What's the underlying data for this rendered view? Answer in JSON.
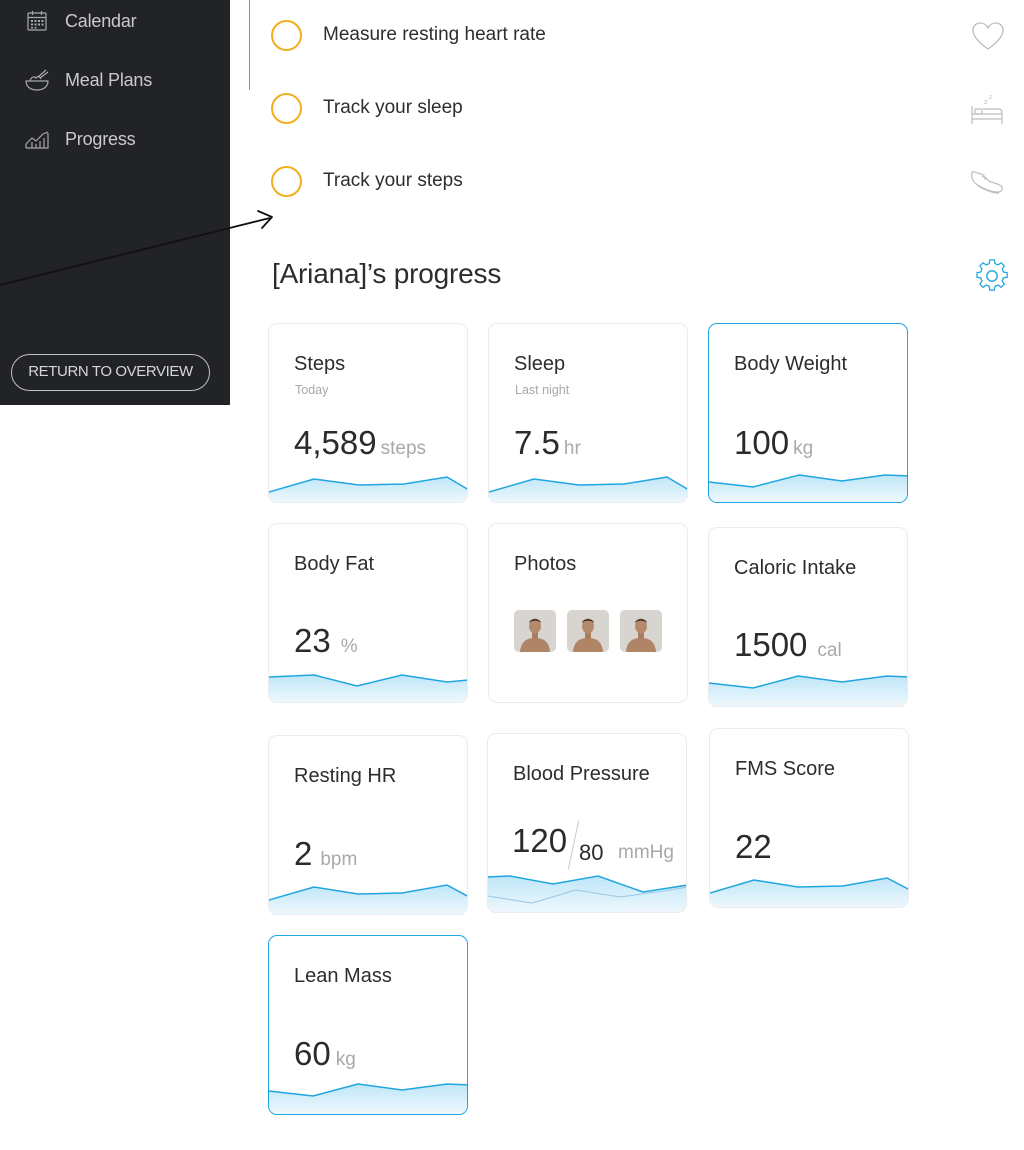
{
  "sidebar": {
    "items": [
      {
        "label": "Calendar",
        "icon": "calendar-icon"
      },
      {
        "label": "Meal Plans",
        "icon": "meal-bowl-icon"
      },
      {
        "label": "Progress",
        "icon": "progress-chart-icon"
      }
    ],
    "return_label": "RETURN TO OVERVIEW"
  },
  "tasks": [
    {
      "label": "Measure resting heart rate"
    },
    {
      "label": "Track your sleep"
    },
    {
      "label": "Track your steps"
    }
  ],
  "right_icons": [
    "heart-icon",
    "sleep-bed-icon",
    "sneaker-icon",
    "gear-icon"
  ],
  "progress": {
    "title": "[Ariana]’s progress",
    "cards": {
      "steps": {
        "title": "Steps",
        "subtitle": "Today",
        "value": "4,589",
        "unit": "steps"
      },
      "sleep": {
        "title": "Sleep",
        "subtitle": "Last night",
        "value": "7.5",
        "unit": "hr"
      },
      "body_weight": {
        "title": "Body Weight",
        "value": "100",
        "unit": "kg"
      },
      "body_fat": {
        "title": "Body Fat",
        "value": "23",
        "unit": "%"
      },
      "photos": {
        "title": "Photos"
      },
      "caloric_intake": {
        "title": "Caloric Intake",
        "value": "1500",
        "unit": "cal"
      },
      "resting_hr": {
        "title": "Resting HR",
        "value": "2",
        "unit": "bpm"
      },
      "blood_pressure": {
        "title": "Blood Pressure",
        "systolic": "120",
        "diastolic": "80",
        "unit": "mmHg"
      },
      "fms_score": {
        "title": "FMS Score",
        "value": "22"
      },
      "lean_mass": {
        "title": "Lean Mass",
        "value": "60",
        "unit": "kg"
      }
    }
  },
  "colors": {
    "sidebar_bg": "#222326",
    "task_circle": "#f2b01e",
    "accent_blue": "#1fa6e0",
    "divider_red": "#e06e75"
  }
}
